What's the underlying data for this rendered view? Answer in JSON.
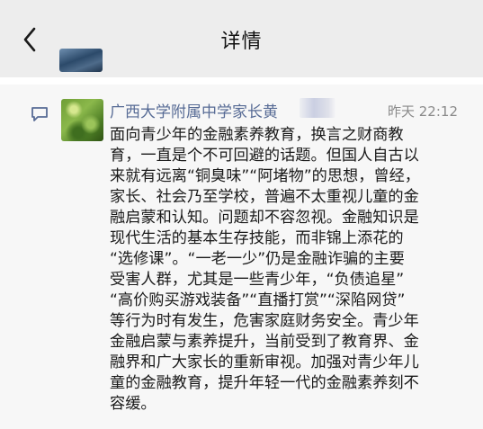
{
  "nav": {
    "title": "详情",
    "back_icon": "chevron-left-icon"
  },
  "comment": {
    "author": "广西大学附属中学家长黄",
    "time": "昨天 22:12",
    "icon": "comment-icon",
    "lines": [
      "面向青少年的金融素养教育，换言之财商教",
      "育，一直是个不可回避的话题。但国人自古以",
      "来就有远离“铜臭味”“阿堵物”的思想，曾经，",
      "家长、社会乃至学校，普遍不太重视儿童的金",
      "融启蒙和认知。问题却不容忽视。金融知识是",
      "现代生活的基本生存技能，而非锦上添花的",
      "“选修课”。“一老一少”仍是金融诈骗的主要",
      "受害人群，尤其是一些青少年，“负债追星”",
      "“高价购买游戏装备”“直播打赏”“深陷网贷”",
      "等行为时有发生，危害家庭财务安全。青少年",
      "金融启蒙与素养提升，当前受到了教育界、金",
      "融界和广大家长的重新审视。加强对青少年儿",
      "童的金融教育，提升年轻一代的金融素养刻不",
      "容缓。"
    ]
  }
}
